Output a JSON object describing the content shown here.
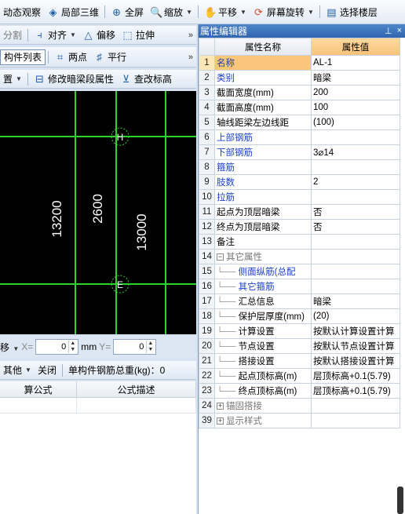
{
  "toolbar1": {
    "items": [
      {
        "label": "动态观察",
        "icon": "orbit-icon"
      },
      {
        "label": "局部三维",
        "icon": "cube-icon"
      },
      {
        "label": "全屏",
        "icon": "fullscreen-icon"
      },
      {
        "label": "缩放",
        "icon": "zoom-icon"
      },
      {
        "label": "平移",
        "icon": "pan-hand-icon"
      },
      {
        "label": "屏幕旋转",
        "icon": "rotate-screen-icon"
      },
      {
        "label": "选择楼层",
        "icon": "floor-select-icon"
      }
    ]
  },
  "toolbar2": {
    "split": "分割",
    "align": "对齐",
    "offset": "偏移",
    "stretch": "拉伸"
  },
  "toolbar3": {
    "component_list": "构件列表",
    "two_point": "两点",
    "parallel": "平行"
  },
  "toolbar4": {
    "layout": "置",
    "modify_segment": "修改暗梁段属性",
    "check_elev": "查改标高"
  },
  "canvas": {
    "dim_left": "13200",
    "dim_mid": "2600",
    "dim_right": "13000",
    "axis_h": "H",
    "axis_e": "E"
  },
  "coordbar": {
    "mode": "移",
    "x_label": "X=",
    "x_value": "0",
    "unit": "mm",
    "y_label": "Y=",
    "y_value": "0"
  },
  "bottombar": {
    "other": "其他",
    "close": "关闭",
    "total_weight": "单构件钢筋总重(kg)：0"
  },
  "formula_table": {
    "col1": "算公式",
    "col2": "公式描述"
  },
  "property_editor": {
    "title": "属性编辑器",
    "pin": "ᵖ",
    "close": "×",
    "header_name": "属性名称",
    "header_value": "属性值",
    "rows": [
      {
        "num": "1",
        "name": "名称",
        "value": "AL-1",
        "style": "sel"
      },
      {
        "num": "2",
        "name": "类别",
        "value": "暗梁",
        "style": "blue"
      },
      {
        "num": "3",
        "name": "截面宽度(mm)",
        "value": "200",
        "style": ""
      },
      {
        "num": "4",
        "name": "截面高度(mm)",
        "value": "100",
        "style": ""
      },
      {
        "num": "5",
        "name": "轴线距梁左边线距",
        "value": "(100)",
        "style": ""
      },
      {
        "num": "6",
        "name": "上部钢筋",
        "value": "",
        "style": "blue"
      },
      {
        "num": "7",
        "name": "下部钢筋",
        "value": "3⌀14",
        "style": "blue"
      },
      {
        "num": "8",
        "name": "箍筋",
        "value": "",
        "style": "blue"
      },
      {
        "num": "9",
        "name": "肢数",
        "value": "2",
        "style": "blue"
      },
      {
        "num": "10",
        "name": "拉筋",
        "value": "",
        "style": "blue"
      },
      {
        "num": "11",
        "name": "起点为顶层暗梁",
        "value": "否",
        "style": ""
      },
      {
        "num": "12",
        "name": "终点为顶层暗梁",
        "value": "否",
        "style": ""
      },
      {
        "num": "13",
        "name": "备注",
        "value": "",
        "style": ""
      },
      {
        "num": "14",
        "name": "其它属性",
        "value": "",
        "style": "gray",
        "expander": "−"
      },
      {
        "num": "15",
        "name": "侧面纵筋(总配",
        "value": "",
        "style": "blue",
        "child": true
      },
      {
        "num": "16",
        "name": "其它箍筋",
        "value": "",
        "style": "blue",
        "child": true
      },
      {
        "num": "17",
        "name": "汇总信息",
        "value": "暗梁",
        "style": "",
        "child": true
      },
      {
        "num": "18",
        "name": "保护层厚度(mm)",
        "value": "(20)",
        "style": "",
        "child": true
      },
      {
        "num": "19",
        "name": "计算设置",
        "value": "按默认计算设置计算",
        "style": "",
        "child": true
      },
      {
        "num": "20",
        "name": "节点设置",
        "value": "按默认节点设置计算",
        "style": "",
        "child": true
      },
      {
        "num": "21",
        "name": "搭接设置",
        "value": "按默认搭接设置计算",
        "style": "",
        "child": true
      },
      {
        "num": "22",
        "name": "起点顶标高(m)",
        "value": "层顶标高+0.1(5.79)",
        "style": "",
        "child": true
      },
      {
        "num": "23",
        "name": "终点顶标高(m)",
        "value": "层顶标高+0.1(5.79)",
        "style": "",
        "child": true
      },
      {
        "num": "24",
        "name": "锚固搭接",
        "value": "",
        "style": "gray",
        "expander": "+"
      },
      {
        "num": "39",
        "name": "显示样式",
        "value": "",
        "style": "gray",
        "expander": "+"
      }
    ]
  }
}
